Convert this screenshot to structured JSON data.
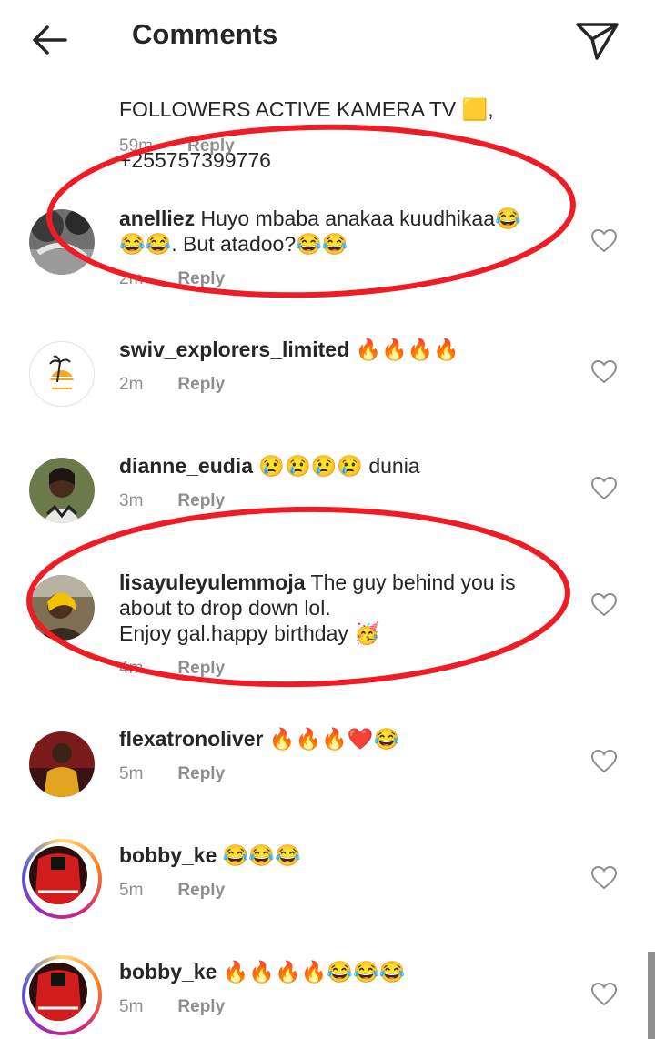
{
  "header": {
    "title": "Comments"
  },
  "partial_comment": {
    "text_line1": "FOLLOWERS ACTIVE KAMERA TV 🟨,",
    "text_line2": "+255757399776",
    "time": "59m",
    "reply": "Reply"
  },
  "comments": [
    {
      "username": "anelliez",
      "text": "Huyo mbaba anakaa kuudhikaa😂😂😂. But atadoo?😂😂",
      "time": "2m",
      "reply": "Reply"
    },
    {
      "username": "swiv_explorers_limited",
      "text": "🔥🔥🔥🔥",
      "time": "2m",
      "reply": "Reply"
    },
    {
      "username": "dianne_eudia",
      "text": "😢😢😢😢 dunia",
      "time": "3m",
      "reply": "Reply"
    },
    {
      "username": "lisayuleyulemmoja",
      "text": "The guy behind you is about to drop down lol.\nEnjoy gal.happy birthday 🥳",
      "time": "4m",
      "reply": "Reply"
    },
    {
      "username": "flexatronoliver",
      "text": "🔥🔥🔥❤️😂",
      "time": "5m",
      "reply": "Reply"
    },
    {
      "username": "bobby_ke",
      "text": "😂😂😂",
      "time": "5m",
      "reply": "Reply"
    },
    {
      "username": "bobby_ke",
      "text": "🔥🔥🔥🔥😂😂😂",
      "time": "5m",
      "reply": "Reply"
    }
  ],
  "colors": {
    "annotation": "#ef1c25",
    "muted": "#8e8e8e",
    "text": "#262626"
  }
}
